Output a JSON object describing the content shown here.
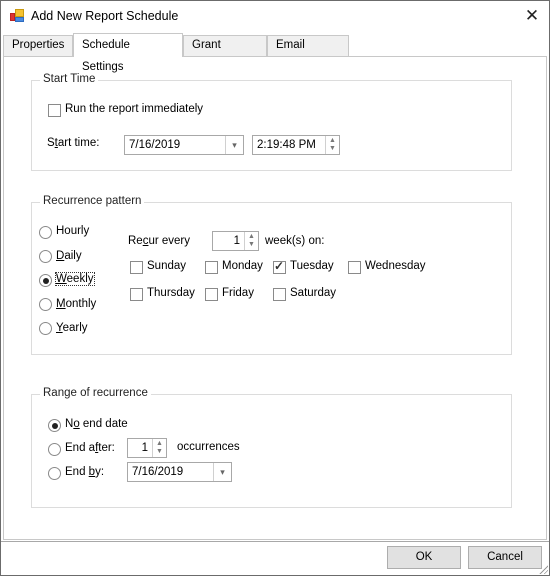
{
  "window": {
    "title": "Add New Report Schedule"
  },
  "tabs": [
    {
      "label": "Properties",
      "active": false
    },
    {
      "label": "Schedule Settings",
      "active": true
    },
    {
      "label": "Grant Access",
      "active": false
    },
    {
      "label": "Email Output",
      "active": false
    }
  ],
  "start_time": {
    "group_label": "Start Time",
    "run_immediately": {
      "label": "Run the report immediately",
      "checked": false
    },
    "start_label_pre": "S",
    "start_label_u": "t",
    "start_label_post": "art time:",
    "date_value": "7/16/2019",
    "time_value": "2:19:48 PM"
  },
  "recurrence": {
    "group_label": "Recurrence pattern",
    "options": [
      {
        "label": "Hourly",
        "u": "",
        "rest": "Hourly",
        "checked": false
      },
      {
        "label": "Daily",
        "u": "D",
        "rest": "aily",
        "checked": false
      },
      {
        "label": "Weekly",
        "u": "W",
        "rest": "eekly",
        "checked": true
      },
      {
        "label": "Monthly",
        "u": "M",
        "rest": "onthly",
        "checked": false
      },
      {
        "label": "Yearly",
        "u": "Y",
        "rest": "early",
        "checked": false
      }
    ],
    "recur_pre": "Re",
    "recur_u": "c",
    "recur_post": "ur every",
    "recur_value": "1",
    "recur_suffix": "week(s) on:",
    "days": [
      {
        "label": "Sunday",
        "checked": false
      },
      {
        "label": "Monday",
        "checked": false
      },
      {
        "label": "Tuesday",
        "checked": true
      },
      {
        "label": "Wednesday",
        "checked": false
      },
      {
        "label": "Thursday",
        "checked": false
      },
      {
        "label": "Friday",
        "checked": false
      },
      {
        "label": "Saturday",
        "checked": false
      }
    ]
  },
  "range": {
    "group_label": "Range of recurrence",
    "no_end": {
      "pre": "N",
      "u": "o",
      "post": " end date",
      "checked": true
    },
    "end_after": {
      "pre": "End a",
      "u": "f",
      "post": "ter:",
      "checked": false,
      "value": "1",
      "suffix": "occurrences"
    },
    "end_by": {
      "pre": "End ",
      "u": "b",
      "post": "y:",
      "checked": false,
      "value": "7/16/2019"
    }
  },
  "buttons": {
    "ok": "OK",
    "cancel": "Cancel"
  }
}
